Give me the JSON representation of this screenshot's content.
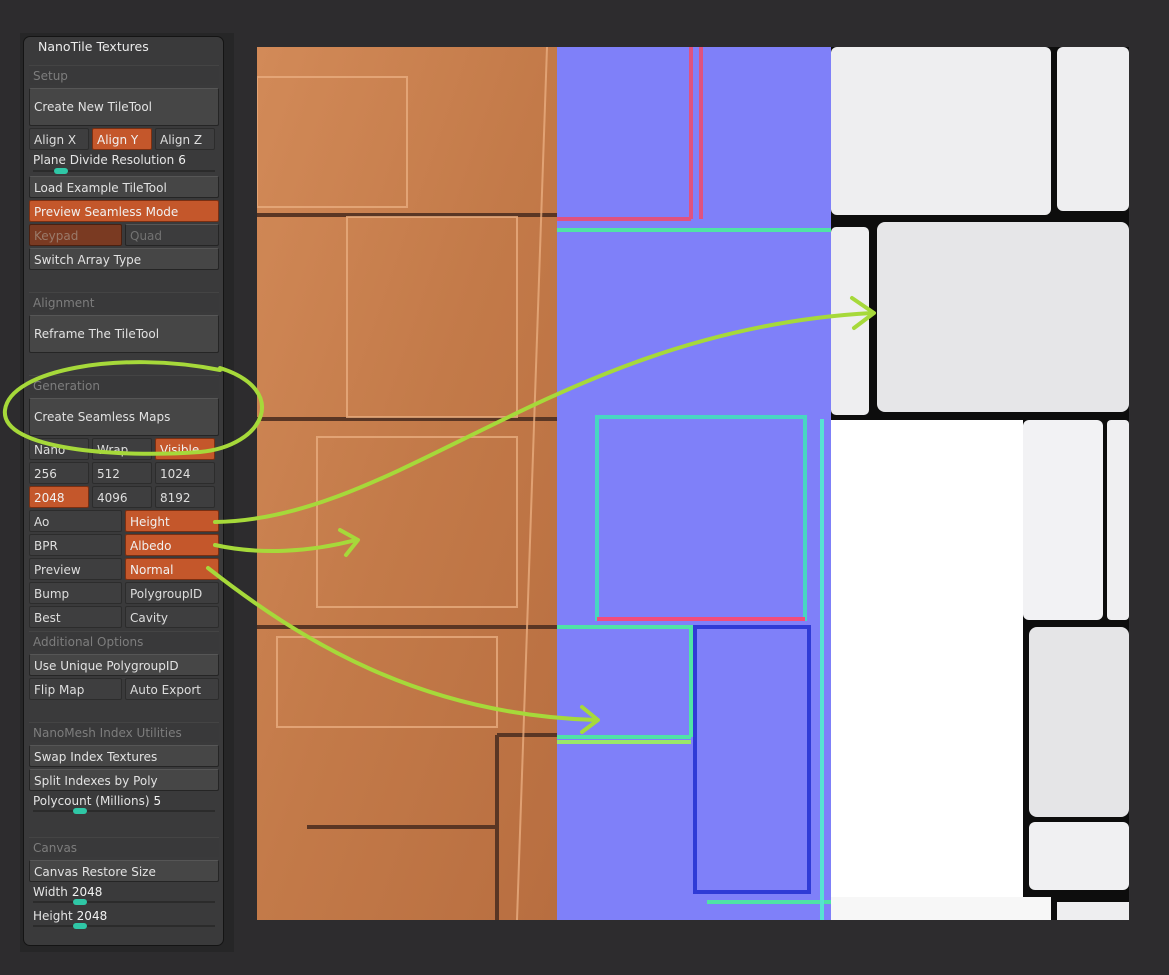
{
  "panel": {
    "title": "NanoTile Textures",
    "setup": {
      "header": "Setup",
      "create_button": "Create New TileTool",
      "align": [
        "Align X",
        "Align Y",
        "Align Z"
      ],
      "align_active": "Align Y",
      "plane_divide": {
        "label": "Plane Divide Resolution",
        "value": "6"
      },
      "load_example": "Load Example TileTool",
      "preview_seamless": "Preview Seamless Mode",
      "keypad": "Keypad",
      "quad": "Quad",
      "switch_array": "Switch Array Type"
    },
    "alignment": {
      "header": "Alignment",
      "reframe": "Reframe The TileTool"
    },
    "generation": {
      "header": "Generation",
      "create_maps": "Create Seamless Maps",
      "modes": [
        "Nano",
        "Wrap",
        "Visible"
      ],
      "mode_active": "Visible",
      "sizes_row1": [
        "256",
        "512",
        "1024"
      ],
      "sizes_row2": [
        "2048",
        "4096",
        "8192"
      ],
      "size_active": "2048",
      "map_left": [
        "Ao",
        "BPR",
        "Preview",
        "Bump",
        "Best"
      ],
      "map_right": [
        "Height",
        "Albedo",
        "Normal",
        "PolygroupID",
        "Cavity"
      ],
      "map_right_active": [
        "Height",
        "Albedo",
        "Normal"
      ],
      "additional_header": "Additional Options",
      "unique_polygroup": "Use Unique PolygroupID",
      "flip_map": "Flip Map",
      "auto_export": "Auto Export"
    },
    "nanomesh": {
      "header": "NanoMesh Index Utilities",
      "swap": "Swap Index Textures",
      "split": "Split Indexes by Poly",
      "polycount": {
        "label": "Polycount (Millions)",
        "value": "5"
      }
    },
    "canvas": {
      "header": "Canvas",
      "restore": "Canvas Restore Size",
      "width": {
        "label": "Width",
        "value": "2048"
      },
      "height": {
        "label": "Height",
        "value": "2048"
      }
    }
  },
  "colors": {
    "active": "#c4572b",
    "slider_knob": "#2fc7a6",
    "annotation": "#a6d93a",
    "albedo": "#c97e4e",
    "normal": "#7f80f9",
    "height": "#eeeef0"
  }
}
